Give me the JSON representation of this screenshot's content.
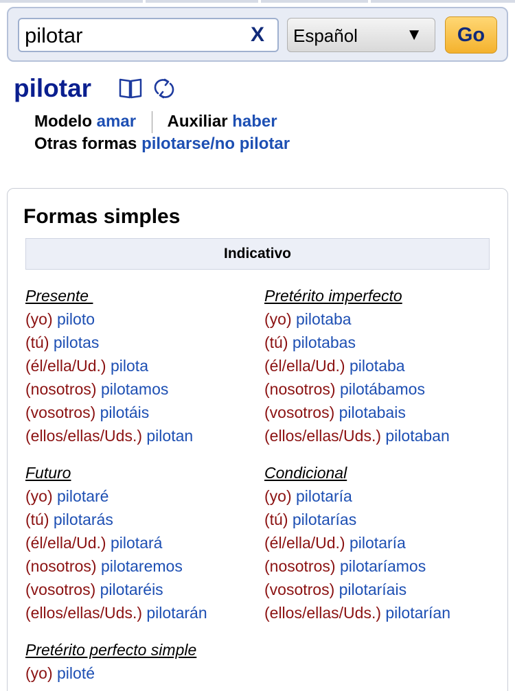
{
  "search": {
    "value": "pilotar",
    "clear_symbol": "X"
  },
  "language": {
    "selected": "Español",
    "caret": "▼"
  },
  "go_label": "Go",
  "verb": {
    "title": "pilotar",
    "modelo_label": "Modelo",
    "modelo_value": "amar",
    "auxiliar_label": "Auxiliar",
    "auxiliar_value": "haber",
    "otras_label": "Otras formas",
    "otras_value": "pilotarse/no pilotar"
  },
  "section_title": "Formas simples",
  "mood": "Indicativo",
  "tenses": {
    "presente": {
      "name": "Presente ",
      "rows": [
        {
          "pron": "(yo)",
          "form": "piloto"
        },
        {
          "pron": "(tú)",
          "form": "pilotas"
        },
        {
          "pron": "(él/ella/Ud.)",
          "form": "pilota"
        },
        {
          "pron": "(nosotros)",
          "form": "pilotamos"
        },
        {
          "pron": "(vosotros)",
          "form": "pilotáis"
        },
        {
          "pron": "(ellos/ellas/Uds.)",
          "form": "pilotan"
        }
      ]
    },
    "imperfecto": {
      "name": "Pretérito imperfecto",
      "rows": [
        {
          "pron": "(yo)",
          "form": "pilotaba"
        },
        {
          "pron": "(tú)",
          "form": "pilotabas"
        },
        {
          "pron": "(él/ella/Ud.)",
          "form": "pilotaba"
        },
        {
          "pron": "(nosotros)",
          "form": "pilotábamos"
        },
        {
          "pron": "(vosotros)",
          "form": "pilotabais"
        },
        {
          "pron": "(ellos/ellas/Uds.)",
          "form": "pilotaban"
        }
      ]
    },
    "futuro": {
      "name": "Futuro",
      "rows": [
        {
          "pron": "(yo)",
          "form": "pilotaré"
        },
        {
          "pron": "(tú)",
          "form": "pilotarás"
        },
        {
          "pron": "(él/ella/Ud.)",
          "form": "pilotará"
        },
        {
          "pron": "(nosotros)",
          "form": "pilotaremos"
        },
        {
          "pron": "(vosotros)",
          "form": "pilotaréis"
        },
        {
          "pron": "(ellos/ellas/Uds.)",
          "form": "pilotarán"
        }
      ]
    },
    "condicional": {
      "name": "Condicional",
      "rows": [
        {
          "pron": "(yo)",
          "form": "pilotaría"
        },
        {
          "pron": "(tú)",
          "form": "pilotarías"
        },
        {
          "pron": "(él/ella/Ud.)",
          "form": "pilotaría"
        },
        {
          "pron": "(nosotros)",
          "form": "pilotaríamos"
        },
        {
          "pron": "(vosotros)",
          "form": "pilotaríais"
        },
        {
          "pron": "(ellos/ellas/Uds.)",
          "form": "pilotarían"
        }
      ]
    },
    "perfecto_simple": {
      "name": "Pretérito perfecto simple",
      "rows": [
        {
          "pron": "(yo)",
          "form": "piloté"
        }
      ]
    }
  },
  "icons": {
    "book": "book-icon",
    "refresh": "refresh-icon"
  },
  "colors": {
    "title": "#0a1f8f",
    "link": "#1d4fb3",
    "pronoun": "#8b1212",
    "go": "#f4b22e"
  }
}
